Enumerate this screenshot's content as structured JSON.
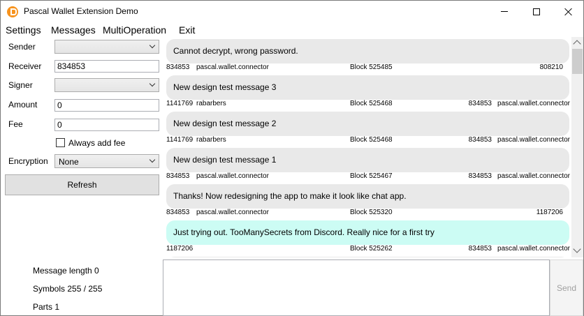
{
  "window": {
    "title": "Pascal Wallet Extension Demo"
  },
  "menu": {
    "items": [
      "Settings",
      "Messages",
      "MultiOperation",
      "Exit"
    ]
  },
  "form": {
    "sender_label": "Sender",
    "sender_value": "",
    "receiver_label": "Receiver",
    "receiver_value": "834853",
    "signer_label": "Signer",
    "signer_value": "",
    "amount_label": "Amount",
    "amount_value": "0",
    "fee_label": "Fee",
    "fee_value": "0",
    "always_add_fee_label": "Always add fee",
    "always_add_fee_checked": false,
    "encryption_label": "Encryption",
    "encryption_value": "None",
    "refresh_label": "Refresh"
  },
  "messages": [
    {
      "text": "Cannot decrypt, wrong password.",
      "from": "834853",
      "from_name": "pascal.wallet.connector",
      "block": "Block  525485",
      "to": "808210",
      "to_name": "",
      "mine": false
    },
    {
      "text": "New design test message 3",
      "from": "1141769",
      "from_name": "rabarbers",
      "block": "Block  525468",
      "to": "834853",
      "to_name": "pascal.wallet.connector",
      "mine": false
    },
    {
      "text": "New design test message 2",
      "from": "1141769",
      "from_name": "rabarbers",
      "block": "Block  525468",
      "to": "834853",
      "to_name": "pascal.wallet.connector",
      "mine": false
    },
    {
      "text": "New design test message 1",
      "from": "834853",
      "from_name": "pascal.wallet.connector",
      "block": "Block  525467",
      "to": "834853",
      "to_name": "pascal.wallet.connector",
      "mine": false
    },
    {
      "text": "Thanks! Now redesigning the app to make it look like chat app.",
      "from": "834853",
      "from_name": "pascal.wallet.connector",
      "block": "Block  525320",
      "to": "1187206",
      "to_name": "",
      "mine": false
    },
    {
      "text": "Just trying out. TooManySecrets from Discord. Really nice for a first try",
      "from": "1187206",
      "from_name": "",
      "block": "Block  525262",
      "to": "834853",
      "to_name": "pascal.wallet.connector",
      "mine": true
    }
  ],
  "stats": {
    "message_length": "Message length  0",
    "symbols": "Symbols  255  /  255",
    "parts": "Parts  1"
  },
  "composer": {
    "message_value": "",
    "send_label": "Send"
  },
  "colors": {
    "bubble": "#e9e9e9",
    "bubble_mine": "#ccfcf4",
    "accent": "#f7931e"
  }
}
